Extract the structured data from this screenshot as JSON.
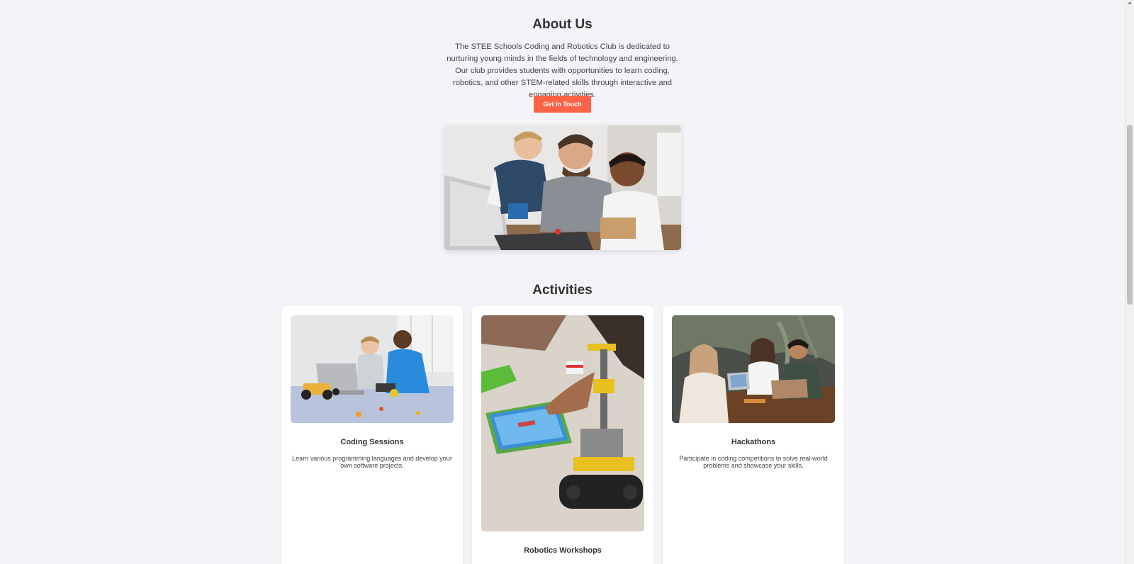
{
  "about": {
    "title": "About Us",
    "text": "The STEE Schools Coding and Robotics Club is dedicated to nurturing young minds in the fields of technology and engineering. Our club provides students with opportunities to learn coding, robotics, and other STEM-related skills through interactive and engaging activities.",
    "cta_label": "Get in Touch"
  },
  "activities": {
    "title": "Activities",
    "cards": [
      {
        "title": "Coding Sessions",
        "description": "Learn various programming languages and develop your own software projects."
      },
      {
        "title": "Robotics Workshops",
        "description": ""
      },
      {
        "title": "Hackathons",
        "description": "Participate in coding competitions to solve real-world problems and showcase your skills."
      }
    ]
  },
  "colors": {
    "accent": "#ff6347",
    "background": "#f4f4f8",
    "card": "#ffffff",
    "text": "#333333"
  }
}
